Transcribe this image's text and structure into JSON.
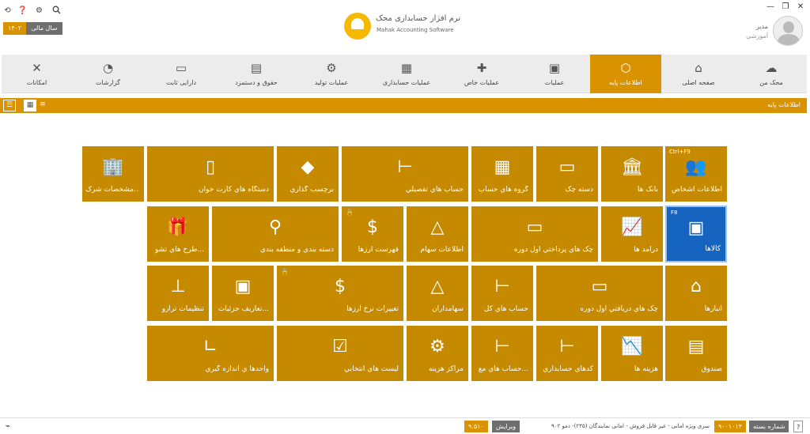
{
  "header": {
    "logo_title": "نرم افزار حسابداری محک",
    "logo_subtitle": "Mahak Accounting Software",
    "fiscal_year_label": "سال مالی",
    "fiscal_year_value": "۱۴۰۲",
    "user_name": "مدیر",
    "user_role": "آموزشی"
  },
  "nav": {
    "items": [
      {
        "label": "محک من",
        "icon": "mahak-icon"
      },
      {
        "label": "صفحه اصلی",
        "icon": "home-icon"
      },
      {
        "label": "اطلاعات پایه",
        "icon": "box-icon"
      },
      {
        "label": "عملیات",
        "icon": "register-icon"
      },
      {
        "label": "عملیات خاص",
        "icon": "puzzle-icon"
      },
      {
        "label": "عملیات حسابداری",
        "icon": "calculator-icon"
      },
      {
        "label": "عملیات تولید",
        "icon": "production-icon"
      },
      {
        "label": "حقوق و دستمزد",
        "icon": "salary-icon"
      },
      {
        "label": "دارایی ثابت",
        "icon": "asset-icon"
      },
      {
        "label": "گزارشات",
        "icon": "report-icon"
      },
      {
        "label": "امکانات",
        "icon": "tools-icon"
      }
    ],
    "active_index": 2
  },
  "section_title": "اطلاعات پایه",
  "tiles": {
    "persons": {
      "label": "اطلاعات اشخاص",
      "shortcut": "Ctrl+F9"
    },
    "banks": {
      "label": "بانک ها"
    },
    "checkbook": {
      "label": "دسته چک"
    },
    "account_groups": {
      "label": "گروه هاي حساب"
    },
    "detail_accounts": {
      "label": "حساب هاي تفصيلي"
    },
    "tagging": {
      "label": "برچسب گذاري"
    },
    "card_readers": {
      "label": "دستگاه هاي کارت خوان"
    },
    "company_specs": {
      "label": "مشخصات شرک..."
    },
    "goods": {
      "label": "کالاها",
      "shortcut": "F8"
    },
    "income": {
      "label": "درآمد ها"
    },
    "paid_cheques": {
      "label": "چک هاي پرداختي اول دوره"
    },
    "shares": {
      "label": "اطلاعات سهام"
    },
    "currency_list": {
      "label": "فهرست ارزها"
    },
    "regions": {
      "label": "دسته بندي و منطقه بندي"
    },
    "promo_plans": {
      "label": "طرح هاي تشو..."
    },
    "warehouses": {
      "label": "انبارها"
    },
    "received_cheques": {
      "label": "چک هاي دريافتي اول دوره"
    },
    "general_accounts": {
      "label": "حساب هاي کل"
    },
    "shareholders": {
      "label": "سهامداران"
    },
    "currency_rates": {
      "label": "تغييرات نرخ ارزها"
    },
    "detail_definitions": {
      "label": "تعاريف جزئيات..."
    },
    "scale_settings": {
      "label": "تنظيمات ترازو"
    },
    "cashbox": {
      "label": "صندوق"
    },
    "expenses": {
      "label": "هزينه ها"
    },
    "accounting_codes": {
      "label": "کدهاي حسابداري"
    },
    "specific_accounts": {
      "label": "حساب هاي مع..."
    },
    "cost_centers": {
      "label": "مراکز هزينه"
    },
    "selection_lists": {
      "label": "ليست هاي انتخابي"
    },
    "units": {
      "label": "واحدها ي اندازه گيري"
    }
  },
  "status": {
    "serial_label": "شماره بسته",
    "serial_value": "۹۰۰۱۰۱۴",
    "series_text": "سری ویژه امانی - غیر قابل فروش - امانی نمایندگان (۲۳۵)- دمو ۹۰۲",
    "version_label": "ویرایش",
    "version_value": "۹.۵۱۰"
  },
  "colors": {
    "accent": "#d99200",
    "tile": "#c58a00",
    "active_tile": "#1565c0"
  }
}
